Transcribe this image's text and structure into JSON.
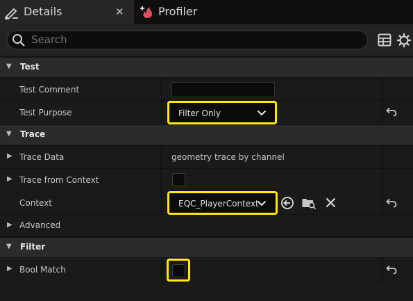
{
  "tabs": [
    {
      "label": "Details",
      "icon": "details-pencil-icon",
      "active": true
    },
    {
      "label": "Profiler",
      "icon": "profiler-icon",
      "active": false
    }
  ],
  "search": {
    "placeholder": "Search"
  },
  "categories": {
    "test": "Test",
    "trace": "Trace",
    "filter": "Filter"
  },
  "properties": {
    "test_comment": {
      "label": "Test Comment",
      "value": ""
    },
    "test_purpose": {
      "label": "Test Purpose",
      "value": "Filter Only"
    },
    "trace_data": {
      "label": "Trace Data",
      "value": "geometry trace by channel"
    },
    "trace_from_context": {
      "label": "Trace from Context",
      "checked": false
    },
    "context": {
      "label": "Context",
      "value": "EQC_PlayerContext"
    },
    "advanced": {
      "label": "Advanced"
    },
    "bool_match": {
      "label": "Bool Match",
      "checked": false
    }
  },
  "colors": {
    "highlight": "#ffea00",
    "background": "#151515",
    "category_bg": "#2b2b2b",
    "profiler_icon": "#e0505a"
  }
}
